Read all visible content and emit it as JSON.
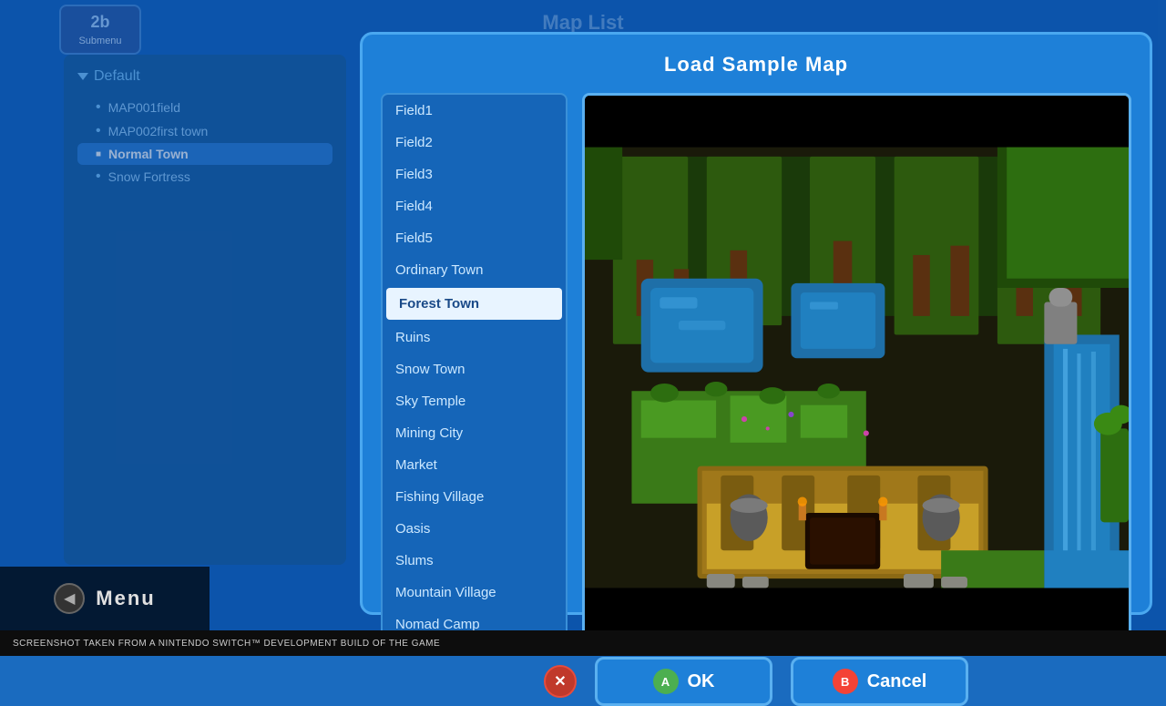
{
  "app": {
    "title": "Map List",
    "bottom_notice": "SCREENSHOT TAKEN FROM A NINTENDO SWITCH™ DEVELOPMENT BUILD OF THE GAME"
  },
  "submenu": {
    "icon": "2b",
    "label": "Submenu"
  },
  "sidebar": {
    "group_label": "Default",
    "items": [
      {
        "id": "map001field",
        "label": "MAP001field",
        "active": false
      },
      {
        "id": "map002first",
        "label": "MAP002first town",
        "active": false
      },
      {
        "id": "normal-town",
        "label": "Normal Town",
        "active": true
      },
      {
        "id": "snow-fortress",
        "label": "Snow Fortress",
        "active": false
      }
    ]
  },
  "dialog": {
    "title": "Load Sample Map",
    "maps": [
      {
        "id": "field1",
        "label": "Field1",
        "selected": false
      },
      {
        "id": "field2",
        "label": "Field2",
        "selected": false
      },
      {
        "id": "field3",
        "label": "Field3",
        "selected": false
      },
      {
        "id": "field4",
        "label": "Field4",
        "selected": false
      },
      {
        "id": "field5",
        "label": "Field5",
        "selected": false
      },
      {
        "id": "ordinary-town",
        "label": "Ordinary Town",
        "selected": false
      },
      {
        "id": "forest-town",
        "label": "Forest Town",
        "selected": true
      },
      {
        "id": "ruins",
        "label": "Ruins",
        "selected": false
      },
      {
        "id": "snow-town",
        "label": "Snow Town",
        "selected": false
      },
      {
        "id": "sky-temple",
        "label": "Sky Temple",
        "selected": false
      },
      {
        "id": "mining-city",
        "label": "Mining City",
        "selected": false
      },
      {
        "id": "market",
        "label": "Market",
        "selected": false
      },
      {
        "id": "fishing-village",
        "label": "Fishing Village",
        "selected": false
      },
      {
        "id": "oasis",
        "label": "Oasis",
        "selected": false
      },
      {
        "id": "slums",
        "label": "Slums",
        "selected": false
      },
      {
        "id": "mountain-village",
        "label": "Mountain Village",
        "selected": false
      },
      {
        "id": "nomad-camp",
        "label": "Nomad Camp",
        "selected": false
      }
    ],
    "buttons": {
      "ok_badge": "A",
      "ok_label": "OK",
      "cancel_badge": "B",
      "cancel_label": "Cancel",
      "close_icon": "✕"
    }
  },
  "menu": {
    "label": "Menu"
  }
}
